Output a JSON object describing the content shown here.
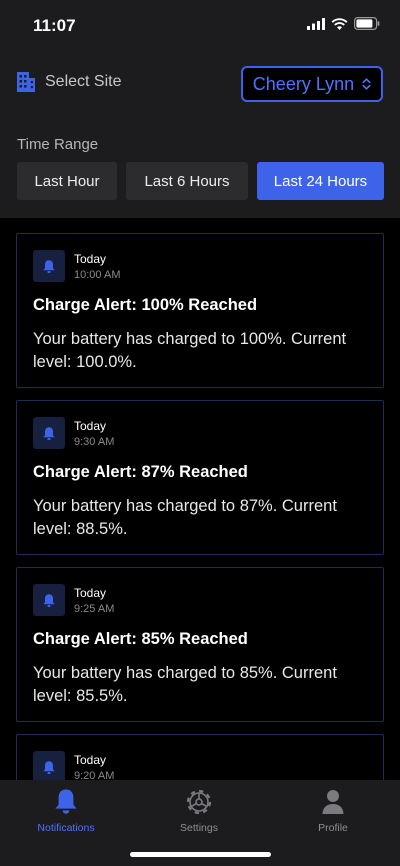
{
  "status_bar": {
    "time": "11:07"
  },
  "header": {
    "site_label": "Select Site",
    "site_value": "Cheery Lynn",
    "time_range_label": "Time Range",
    "ranges": [
      {
        "label": "Last Hour",
        "active": false
      },
      {
        "label": "Last 6 Hours",
        "active": false
      },
      {
        "label": "Last 24 Hours",
        "active": true
      }
    ]
  },
  "notifications": [
    {
      "day": "Today",
      "time": "10:00 AM",
      "title": "Charge Alert: 100% Reached",
      "body": "Your battery has charged to 100%. Current level: 100.0%."
    },
    {
      "day": "Today",
      "time": "9:30 AM",
      "title": "Charge Alert: 87% Reached",
      "body": "Your battery has charged to 87%. Current level: 88.5%."
    },
    {
      "day": "Today",
      "time": "9:25 AM",
      "title": "Charge Alert: 85% Reached",
      "body": "Your battery has charged to 85%. Current level: 85.5%."
    },
    {
      "day": "Today",
      "time": "9:20 AM"
    }
  ],
  "tabs": [
    {
      "label": "Notifications",
      "icon": "bell-icon",
      "active": true
    },
    {
      "label": "Settings",
      "icon": "gear-icon",
      "active": false
    },
    {
      "label": "Profile",
      "icon": "person-icon",
      "active": false
    }
  ],
  "colors": {
    "accent": "#3d63e8",
    "accent_text": "#4d74ff",
    "surface": "#1c1c1e",
    "card_border": "#1f2c55"
  }
}
